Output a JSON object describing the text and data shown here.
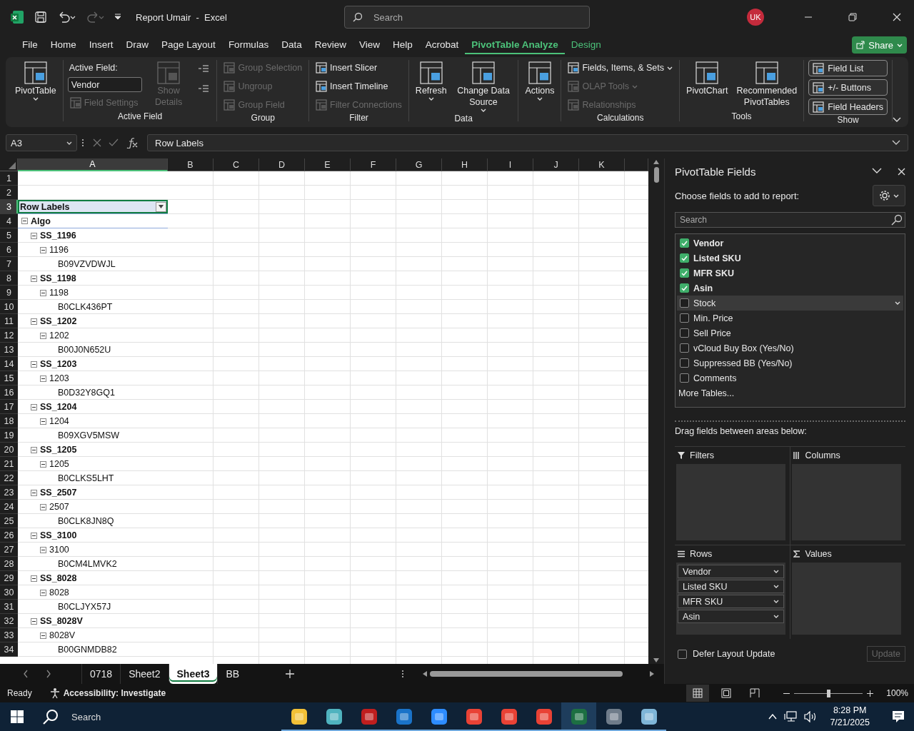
{
  "window": {
    "title": "Report Umair  -  Excel",
    "account": "UK"
  },
  "search": {
    "placeholder": "Search"
  },
  "menu": [
    {
      "label": "File",
      "selected": false,
      "contextual": false
    },
    {
      "label": "Home",
      "selected": false,
      "contextual": false
    },
    {
      "label": "Insert",
      "selected": false,
      "contextual": false
    },
    {
      "label": "Draw",
      "selected": false,
      "contextual": false
    },
    {
      "label": "Page Layout",
      "selected": false,
      "contextual": false
    },
    {
      "label": "Formulas",
      "selected": false,
      "contextual": false
    },
    {
      "label": "Data",
      "selected": false,
      "contextual": false
    },
    {
      "label": "Review",
      "selected": false,
      "contextual": false
    },
    {
      "label": "View",
      "selected": false,
      "contextual": false
    },
    {
      "label": "Help",
      "selected": false,
      "contextual": false
    },
    {
      "label": "Acrobat",
      "selected": false,
      "contextual": false
    },
    {
      "label": "PivotTable Analyze",
      "selected": true,
      "contextual": true
    },
    {
      "label": "Design",
      "selected": false,
      "contextual": true
    }
  ],
  "share": "Share",
  "ribbon": {
    "groups": [
      {
        "columns": [
          [
            {
              "kind": "large",
              "label": "PivotTable",
              "dropdown": true,
              "disabled": false
            }
          ]
        ]
      },
      {
        "label": "Active Field",
        "columns": [
          [
            {
              "kind": "caption",
              "label": "Active Field:"
            },
            {
              "kind": "field",
              "value": "Vendor"
            },
            {
              "kind": "small",
              "label": "Field Settings",
              "dropdown": false,
              "disabled": true
            }
          ],
          [
            {
              "kind": "large",
              "label": "Show Details",
              "dropdown": false,
              "disabled": true
            }
          ],
          [
            {
              "kind": "tiny",
              "disabled": false
            },
            {
              "kind": "tiny",
              "disabled": false
            }
          ]
        ]
      },
      {
        "label": "Group",
        "columns": [
          [
            {
              "kind": "small",
              "label": "Group Selection",
              "dropdown": false,
              "disabled": true
            },
            {
              "kind": "small",
              "label": "Ungroup",
              "dropdown": false,
              "disabled": true
            },
            {
              "kind": "small",
              "label": "Group Field",
              "dropdown": false,
              "disabled": true
            }
          ]
        ]
      },
      {
        "label": "Filter",
        "columns": [
          [
            {
              "kind": "small",
              "label": "Insert Slicer",
              "dropdown": false,
              "disabled": false
            },
            {
              "kind": "small",
              "label": "Insert Timeline",
              "dropdown": false,
              "disabled": false
            },
            {
              "kind": "small",
              "label": "Filter Connections",
              "dropdown": false,
              "disabled": true
            }
          ]
        ]
      },
      {
        "label": "Data",
        "columns": [
          [
            {
              "kind": "large",
              "label": "Refresh",
              "dropdown": true,
              "disabled": false
            }
          ],
          [
            {
              "kind": "large",
              "label": "Change Data Source",
              "dropdown": true,
              "disabled": false
            }
          ]
        ]
      },
      {
        "columns": [
          [
            {
              "kind": "large",
              "label": "Actions",
              "dropdown": true,
              "disabled": false
            }
          ]
        ]
      },
      {
        "label": "Calculations",
        "columns": [
          [
            {
              "kind": "small",
              "label": "Fields, Items, & Sets",
              "dropdown": true,
              "disabled": false
            },
            {
              "kind": "small",
              "label": "OLAP Tools",
              "dropdown": true,
              "disabled": true
            },
            {
              "kind": "small",
              "label": "Relationships",
              "dropdown": false,
              "disabled": true
            }
          ]
        ]
      },
      {
        "label": "Tools",
        "columns": [
          [
            {
              "kind": "large",
              "label": "PivotChart",
              "dropdown": false,
              "disabled": false
            }
          ],
          [
            {
              "kind": "large",
              "label": "Recommended PivotTables",
              "dropdown": false,
              "disabled": false
            }
          ]
        ]
      },
      {
        "label": "Show",
        "columns": [
          [
            {
              "kind": "toggle",
              "label": "Field List",
              "on": true
            },
            {
              "kind": "toggle",
              "label": "+/- Buttons",
              "on": true
            },
            {
              "kind": "toggle",
              "label": "Field Headers",
              "on": true
            }
          ]
        ]
      }
    ]
  },
  "formula_bar": {
    "name_box": "A3",
    "formula": "Row Labels"
  },
  "sheet": {
    "columns": [
      {
        "label": "A",
        "selected": true
      },
      {
        "label": "B",
        "selected": false
      },
      {
        "label": "C",
        "selected": false
      },
      {
        "label": "D",
        "selected": false
      },
      {
        "label": "E",
        "selected": false
      },
      {
        "label": "F",
        "selected": false
      },
      {
        "label": "G",
        "selected": false
      },
      {
        "label": "H",
        "selected": false
      },
      {
        "label": "I",
        "selected": false
      },
      {
        "label": "J",
        "selected": false
      },
      {
        "label": "K",
        "selected": false
      }
    ],
    "row_numbers": [
      {
        "label": "1",
        "selected": false
      },
      {
        "label": "2",
        "selected": false
      },
      {
        "label": "3",
        "selected": true
      },
      {
        "label": "4",
        "selected": false
      },
      {
        "label": "5",
        "selected": false
      },
      {
        "label": "6",
        "selected": false
      },
      {
        "label": "7",
        "selected": false
      },
      {
        "label": "8",
        "selected": false
      },
      {
        "label": "9",
        "selected": false
      },
      {
        "label": "10",
        "selected": false
      },
      {
        "label": "11",
        "selected": false
      },
      {
        "label": "12",
        "selected": false
      },
      {
        "label": "13",
        "selected": false
      },
      {
        "label": "14",
        "selected": false
      },
      {
        "label": "15",
        "selected": false
      },
      {
        "label": "16",
        "selected": false
      },
      {
        "label": "17",
        "selected": false
      },
      {
        "label": "18",
        "selected": false
      },
      {
        "label": "19",
        "selected": false
      },
      {
        "label": "20",
        "selected": false
      },
      {
        "label": "21",
        "selected": false
      },
      {
        "label": "22",
        "selected": false
      },
      {
        "label": "23",
        "selected": false
      },
      {
        "label": "24",
        "selected": false
      },
      {
        "label": "25",
        "selected": false
      },
      {
        "label": "26",
        "selected": false
      },
      {
        "label": "27",
        "selected": false
      },
      {
        "label": "28",
        "selected": false
      },
      {
        "label": "29",
        "selected": false
      },
      {
        "label": "30",
        "selected": false
      },
      {
        "label": "31",
        "selected": false
      },
      {
        "label": "32",
        "selected": false
      },
      {
        "label": "33",
        "selected": false
      },
      {
        "label": "34",
        "selected": false
      }
    ],
    "pivot": {
      "header": "Row Labels",
      "rows": [
        {
          "label": "Algo",
          "expanded": true,
          "children": [
            {
              "label": "SS_1196",
              "expanded": true,
              "children": [
                {
                  "label": "1196",
                  "expanded": true,
                  "children": [
                    {
                      "label": "B09VZVDWJL"
                    }
                  ]
                }
              ]
            },
            {
              "label": "SS_1198",
              "expanded": true,
              "children": [
                {
                  "label": "1198",
                  "expanded": true,
                  "children": [
                    {
                      "label": "B0CLK436PT"
                    }
                  ]
                }
              ]
            },
            {
              "label": "SS_1202",
              "expanded": true,
              "children": [
                {
                  "label": "1202",
                  "expanded": true,
                  "children": [
                    {
                      "label": "B00J0N652U"
                    }
                  ]
                }
              ]
            },
            {
              "label": "SS_1203",
              "expanded": true,
              "children": [
                {
                  "label": "1203",
                  "expanded": true,
                  "children": [
                    {
                      "label": "B0D32Y8GQ1"
                    }
                  ]
                }
              ]
            },
            {
              "label": "SS_1204",
              "expanded": true,
              "children": [
                {
                  "label": "1204",
                  "expanded": true,
                  "children": [
                    {
                      "label": "B09XGV5MSW"
                    }
                  ]
                }
              ]
            },
            {
              "label": "SS_1205",
              "expanded": true,
              "children": [
                {
                  "label": "1205",
                  "expanded": true,
                  "children": [
                    {
                      "label": "B0CLKS5LHT"
                    }
                  ]
                }
              ]
            },
            {
              "label": "SS_2507",
              "expanded": true,
              "children": [
                {
                  "label": "2507",
                  "expanded": true,
                  "children": [
                    {
                      "label": "B0CLK8JN8Q"
                    }
                  ]
                }
              ]
            },
            {
              "label": "SS_3100",
              "expanded": true,
              "children": [
                {
                  "label": "3100",
                  "expanded": true,
                  "children": [
                    {
                      "label": "B0CM4LMVK2"
                    }
                  ]
                }
              ]
            },
            {
              "label": "SS_8028",
              "expanded": true,
              "children": [
                {
                  "label": "8028",
                  "expanded": true,
                  "children": [
                    {
                      "label": "B0CLJYX57J"
                    }
                  ]
                }
              ]
            },
            {
              "label": "SS_8028V",
              "expanded": true,
              "children": [
                {
                  "label": "8028V",
                  "expanded": true,
                  "children": [
                    {
                      "label": "B00GNMDB82"
                    }
                  ]
                }
              ]
            }
          ]
        }
      ]
    }
  },
  "sheet_tabs": [
    {
      "label": "0718",
      "selected": false
    },
    {
      "label": "Sheet2",
      "selected": false
    },
    {
      "label": "Sheet3",
      "selected": true
    },
    {
      "label": "BB",
      "selected": false
    }
  ],
  "pivot_pane": {
    "title": "PivotTable Fields",
    "subtitle": "Choose fields to add to report:",
    "search_placeholder": "Search",
    "fields": [
      {
        "label": "Vendor",
        "checked": true,
        "selected": false
      },
      {
        "label": "Listed SKU",
        "checked": true,
        "selected": false
      },
      {
        "label": "MFR SKU",
        "checked": true,
        "selected": false
      },
      {
        "label": "Asin",
        "checked": true,
        "selected": false
      },
      {
        "label": "Stock",
        "checked": false,
        "selected": true
      },
      {
        "label": "Min. Price",
        "checked": false,
        "selected": false
      },
      {
        "label": "Sell Price",
        "checked": false,
        "selected": false
      },
      {
        "label": "vCloud Buy Box (Yes/No)",
        "checked": false,
        "selected": false
      },
      {
        "label": "Suppressed BB (Yes/No)",
        "checked": false,
        "selected": false
      },
      {
        "label": "Comments",
        "checked": false,
        "selected": false
      }
    ],
    "more_tables": "More Tables...",
    "drag_hint": "Drag fields between areas below:",
    "areas": [
      {
        "kind": "filters",
        "title": "Filters"
      },
      {
        "kind": "columns",
        "title": "Columns"
      },
      {
        "kind": "rows",
        "title": "Rows",
        "items": [
          "Vendor",
          "Listed SKU",
          "MFR SKU",
          "Asin"
        ]
      },
      {
        "kind": "values",
        "title": "Values"
      }
    ],
    "defer": {
      "label": "Defer Layout Update",
      "checked": false
    },
    "update": {
      "label": "Update",
      "disabled": true
    }
  },
  "status_bar": {
    "status": "Ready",
    "accessibility": "Accessibility: Investigate",
    "views": [
      {
        "selected": true
      },
      {
        "selected": false
      },
      {
        "selected": false
      }
    ],
    "zoom": {
      "level": 0.5,
      "reading": "100%"
    }
  },
  "taskbar": {
    "search": "Search",
    "apps": [
      {
        "color": "#f2c037",
        "selected": false
      },
      {
        "color": "#4fb3bf",
        "selected": false
      },
      {
        "color": "#bf1e1e",
        "selected": false
      },
      {
        "color": "#1a73c8",
        "selected": false
      },
      {
        "color": "#2d8cff",
        "selected": false
      },
      {
        "color": "#e94235",
        "selected": false
      },
      {
        "color": "#e94235",
        "selected": false
      },
      {
        "color": "#e94235",
        "selected": false
      },
      {
        "color": "#1d6f42",
        "selected": true
      },
      {
        "color": "#6f7c8a",
        "selected": false
      },
      {
        "color": "#7fb6d8",
        "selected": false
      }
    ],
    "time": "8:28 PM",
    "date": "7/21/2025"
  }
}
